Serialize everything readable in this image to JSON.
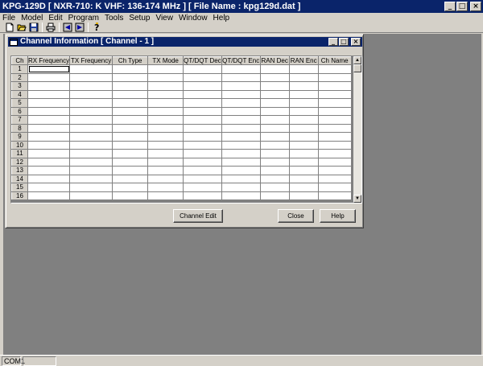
{
  "app": {
    "title": "KPG-129D  [ NXR-710: K  VHF: 136-174 MHz ] [ File Name : kpg129d.dat ]"
  },
  "window_buttons": {
    "minimize": "_",
    "maximize": "□",
    "close": "×"
  },
  "menu": [
    {
      "label": "File"
    },
    {
      "label": "Model"
    },
    {
      "label": "Edit"
    },
    {
      "label": "Program"
    },
    {
      "label": "Tools"
    },
    {
      "label": "Setup"
    },
    {
      "label": "View"
    },
    {
      "label": "Window"
    },
    {
      "label": "Help"
    }
  ],
  "toolbar": {
    "icons": [
      "new-file-icon",
      "open-folder-icon",
      "save-disk-icon",
      "print-icon",
      "read-radio-icon",
      "write-radio-icon",
      "help-question-icon"
    ]
  },
  "child_window": {
    "title": "Channel Information [ Channel - 1 ]"
  },
  "grid": {
    "columns": [
      "Ch",
      "RX Frequency",
      "TX Frequency",
      "Ch Type",
      "TX Mode",
      "QT/DQT Dec",
      "QT/DQT Enc",
      "RAN Dec",
      "RAN Enc",
      "Ch Name"
    ],
    "rows": [
      "1",
      "2",
      "3",
      "4",
      "5",
      "6",
      "7",
      "8",
      "9",
      "10",
      "11",
      "12",
      "13",
      "14",
      "15",
      "16"
    ]
  },
  "buttons": {
    "channel_edit": "Channel Edit",
    "close": "Close",
    "help": "Help"
  },
  "statusbar": {
    "port": "COM1"
  },
  "colors": {
    "titlebar": "#0a246a",
    "face": "#d4d0c8",
    "mdi_background": "#808080"
  }
}
